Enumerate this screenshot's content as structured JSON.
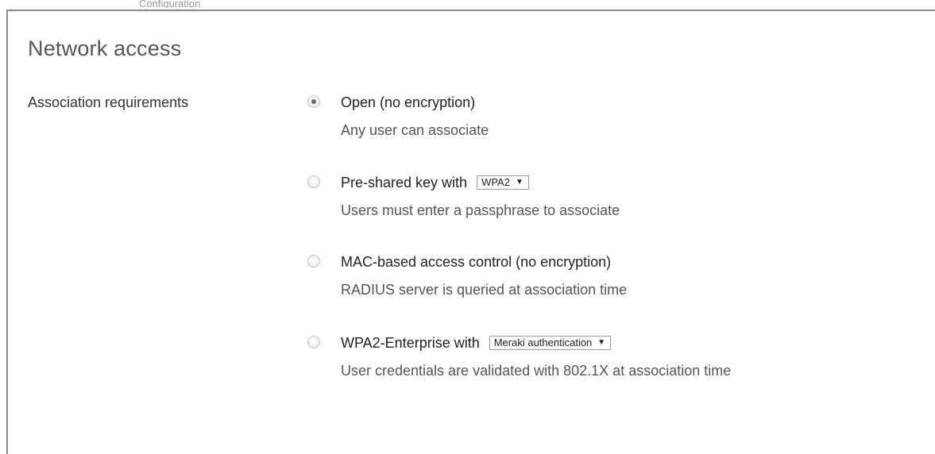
{
  "header_partial_text": "Configuration",
  "section": {
    "title": "Network access"
  },
  "association": {
    "label": "Association requirements",
    "options": [
      {
        "title": "Open (no encryption)",
        "description": "Any user can associate",
        "selected": true
      },
      {
        "title": "Pre-shared key with",
        "description": "Users must enter a passphrase to associate",
        "selected": false,
        "select_value": "WPA2"
      },
      {
        "title": "MAC-based access control (no encryption)",
        "description": "RADIUS server is queried at association time",
        "selected": false
      },
      {
        "title": "WPA2-Enterprise with",
        "description": "User credentials are validated with 802.1X at association time",
        "selected": false,
        "select_value": "Meraki authentication"
      }
    ]
  },
  "icons": {
    "dropdown_arrow": "▼"
  }
}
